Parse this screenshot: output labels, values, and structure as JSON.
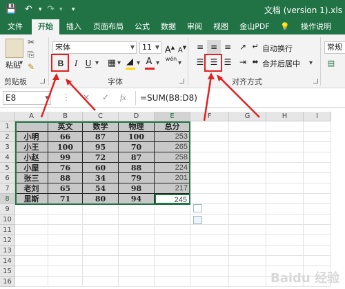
{
  "title_bar": {
    "doc_title": "文档 (version 1).xls",
    "save_icon": "save-icon",
    "undo_icon": "undo-icon",
    "redo_icon": "redo-icon"
  },
  "tabs": [
    "文件",
    "开始",
    "插入",
    "页面布局",
    "公式",
    "数据",
    "审阅",
    "视图",
    "金山PDF",
    "操作说明"
  ],
  "active_tab": "开始",
  "ribbon": {
    "clipboard": {
      "paste_label": "粘贴",
      "group_label": "剪贴板"
    },
    "font": {
      "font_name": "宋体",
      "font_size": "11",
      "group_label": "字体",
      "bold": "B",
      "italic": "I",
      "underline": "U",
      "grow": "A",
      "shrink": "A",
      "font_color_glyph": "A",
      "phonetic": "wén"
    },
    "alignment": {
      "wrap_text": "自动换行",
      "merge_center": "合并后居中",
      "group_label": "对齐方式"
    },
    "number": {
      "format": "常规"
    }
  },
  "formula_bar": {
    "name_box": "E8",
    "formula": "=SUM(B8:D8)",
    "cancel": "×",
    "enter": "✓",
    "fx": "fx"
  },
  "grid": {
    "columns": [
      "A",
      "B",
      "C",
      "D",
      "E",
      "F",
      "G",
      "H",
      "I"
    ],
    "rows": [
      "1",
      "2",
      "3",
      "4",
      "5",
      "6",
      "7",
      "8",
      "9",
      "10",
      "11",
      "12",
      "13",
      "14",
      "15",
      "16"
    ],
    "header_row": [
      "",
      "英文",
      "数学",
      "物理",
      "总分"
    ],
    "data": [
      [
        "小明",
        "66",
        "87",
        "100",
        "253"
      ],
      [
        "小王",
        "100",
        "95",
        "70",
        "265"
      ],
      [
        "小赵",
        "99",
        "72",
        "87",
        "258"
      ],
      [
        "小屋",
        "76",
        "60",
        "88",
        "224"
      ],
      [
        "张三",
        "88",
        "34",
        "79",
        "201"
      ],
      [
        "老刘",
        "65",
        "54",
        "98",
        "217"
      ],
      [
        "里斯",
        "71",
        "80",
        "94",
        "245"
      ]
    ]
  },
  "watermark": "Baidu 经验"
}
